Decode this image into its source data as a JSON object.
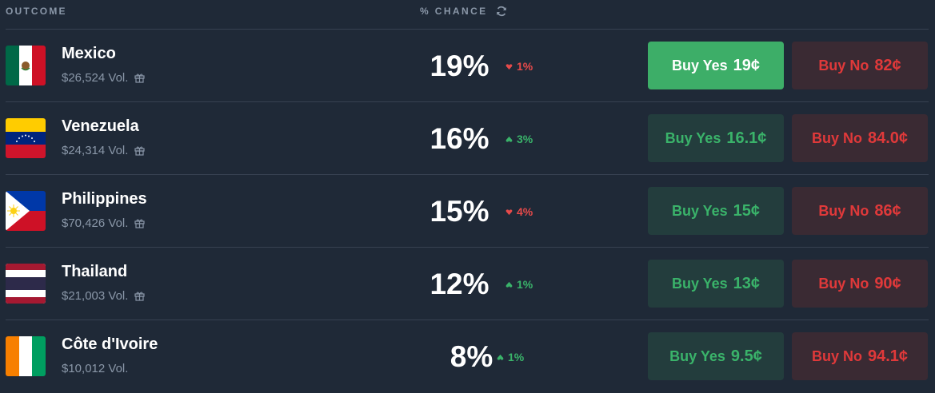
{
  "header": {
    "outcome_label": "OUTCOME",
    "chance_label": "% CHANCE",
    "refresh_icon": "refresh-icon"
  },
  "colors": {
    "background": "#1f2937",
    "yes_active_bg": "#3dae68",
    "yes_bg": "#233d3d",
    "yes_text": "#3ab36a",
    "no_bg": "#3a2a33",
    "no_text": "#e0393a",
    "down": "#e64a4a",
    "up": "#3ab36a"
  },
  "outcomes": [
    {
      "name": "Mexico",
      "volume": "$26,524 Vol.",
      "gift": true,
      "chance": "19%",
      "delta": "1%",
      "direction": "down",
      "yes_label": "Buy Yes",
      "yes_price": "19¢",
      "no_label": "Buy No",
      "no_price": "82¢",
      "yes_active": true,
      "flag": "mexico-flag-icon"
    },
    {
      "name": "Venezuela",
      "volume": "$24,314 Vol.",
      "gift": true,
      "chance": "16%",
      "delta": "3%",
      "direction": "up",
      "yes_label": "Buy Yes",
      "yes_price": "16.1¢",
      "no_label": "Buy No",
      "no_price": "84.0¢",
      "yes_active": false,
      "flag": "venezuela-flag-icon"
    },
    {
      "name": "Philippines",
      "volume": "$70,426 Vol.",
      "gift": true,
      "chance": "15%",
      "delta": "4%",
      "direction": "down",
      "yes_label": "Buy Yes",
      "yes_price": "15¢",
      "no_label": "Buy No",
      "no_price": "86¢",
      "yes_active": false,
      "flag": "philippines-flag-icon"
    },
    {
      "name": "Thailand",
      "volume": "$21,003 Vol.",
      "gift": true,
      "chance": "12%",
      "delta": "1%",
      "direction": "up",
      "yes_label": "Buy Yes",
      "yes_price": "13¢",
      "no_label": "Buy No",
      "no_price": "90¢",
      "yes_active": false,
      "flag": "thailand-flag-icon"
    },
    {
      "name": "Côte d'Ivoire",
      "volume": "$10,012 Vol.",
      "gift": false,
      "chance": "8%",
      "delta": "1%",
      "direction": "up",
      "yes_label": "Buy Yes",
      "yes_price": "9.5¢",
      "no_label": "Buy No",
      "no_price": "94.1¢",
      "yes_active": false,
      "flag": "cote-divoire-flag-icon"
    }
  ]
}
